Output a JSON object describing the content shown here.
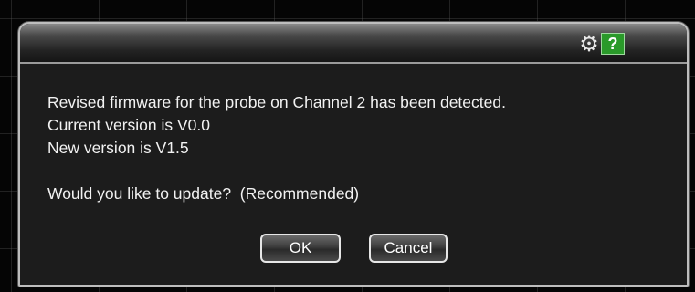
{
  "toolbar": {
    "settings_icon": "gear-icon",
    "help_label": "?"
  },
  "message": {
    "line1": "Revised firmware for the probe on Channel 2 has been detected.",
    "line2": "Current version is V0.0",
    "line3": "New version is V1.5",
    "question": "Would you like to update?  (Recommended)"
  },
  "buttons": {
    "ok_label": "OK",
    "cancel_label": "Cancel"
  },
  "colors": {
    "help_button": "#2a9a2a",
    "dialog_background": "#1c1c1c"
  }
}
